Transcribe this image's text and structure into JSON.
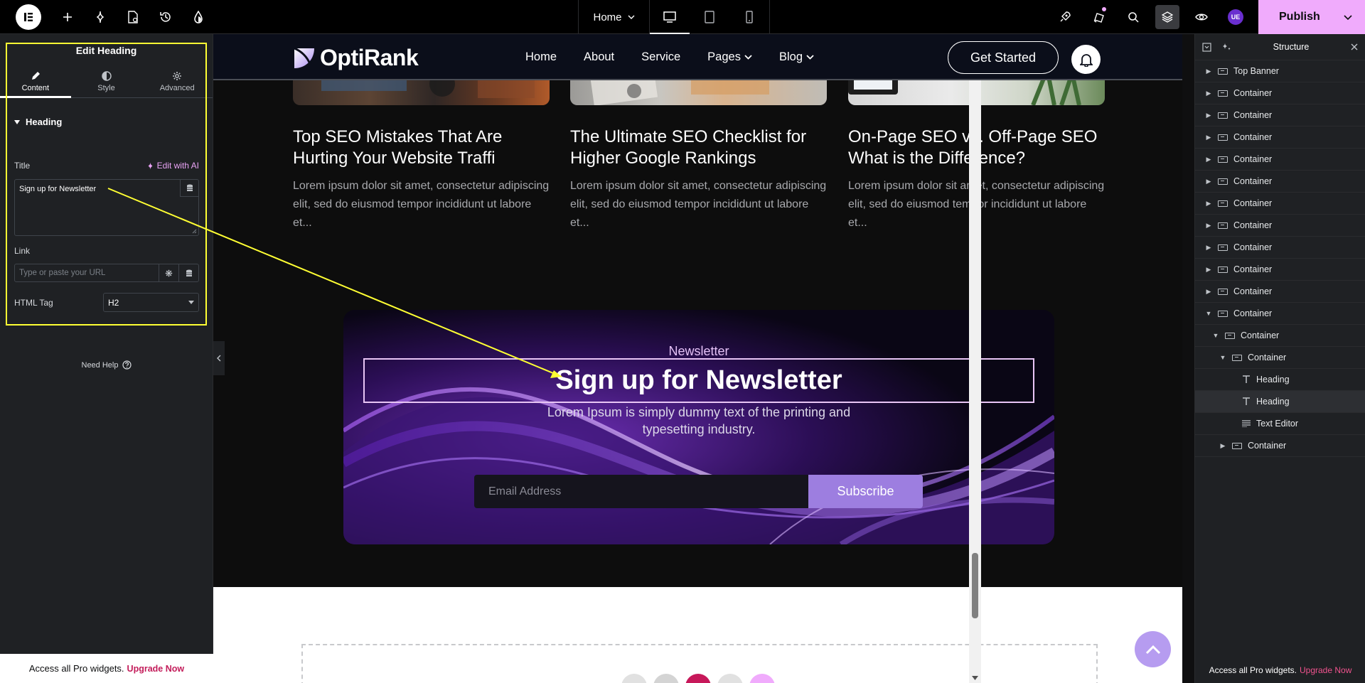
{
  "topbar": {
    "page_select": "Home",
    "publish_label": "Publish",
    "user_initials": "UE"
  },
  "left_panel": {
    "title": "Edit Heading",
    "tabs": [
      {
        "label": "Content",
        "icon": "pencil-icon",
        "active": true
      },
      {
        "label": "Style",
        "icon": "half-circle-icon",
        "active": false
      },
      {
        "label": "Advanced",
        "icon": "gear-icon",
        "active": false
      }
    ],
    "section_title": "Heading",
    "title_label": "Title",
    "edit_with_ai": "Edit with AI",
    "title_value": "Sign up for Newsletter",
    "link_label": "Link",
    "link_placeholder": "Type or paste your URL",
    "html_tag_label": "HTML Tag",
    "html_tag_value": "H2",
    "need_help": "Need Help",
    "pro_text": "Access all Pro widgets.",
    "upgrade": "Upgrade Now"
  },
  "site": {
    "brand": "OptiRank",
    "nav": [
      "Home",
      "About",
      "Service",
      "Pages",
      "Blog"
    ],
    "cta": "Get Started",
    "posts": [
      {
        "title": "Top SEO Mistakes That Are Hurting Your Website Traffi",
        "excerpt": "Lorem ipsum dolor sit amet, consectetur adipiscing elit, sed do eiusmod tempor incididunt ut labore et..."
      },
      {
        "title": "The Ultimate SEO Checklist for Higher Google Rankings",
        "excerpt": "Lorem ipsum dolor sit amet, consectetur adipiscing elit, sed do eiusmod tempor incididunt ut labore et..."
      },
      {
        "title": "On-Page SEO vs. Off-Page SEO What is the Difference?",
        "excerpt": "Lorem ipsum dolor sit amet, consectetur adipiscing elit, sed do eiusmod tempor incididunt ut labore et..."
      }
    ],
    "newsletter": {
      "eyebrow": "Newsletter",
      "heading": "Sign up for Newsletter",
      "text": "Lorem Ipsum is simply dummy text of the printing and typesetting industry.",
      "email_placeholder": "Email Address",
      "subscribe": "Subscribe"
    }
  },
  "structure": {
    "title": "Structure",
    "items": [
      {
        "label": "Top Banner",
        "depth": 0,
        "caret": "right",
        "icon": "container-icon"
      },
      {
        "label": "Container",
        "depth": 0,
        "caret": "right",
        "icon": "container-icon"
      },
      {
        "label": "Container",
        "depth": 0,
        "caret": "right",
        "icon": "container-icon"
      },
      {
        "label": "Container",
        "depth": 0,
        "caret": "right",
        "icon": "container-icon"
      },
      {
        "label": "Container",
        "depth": 0,
        "caret": "right",
        "icon": "container-icon"
      },
      {
        "label": "Container",
        "depth": 0,
        "caret": "right",
        "icon": "container-icon"
      },
      {
        "label": "Container",
        "depth": 0,
        "caret": "right",
        "icon": "container-icon"
      },
      {
        "label": "Container",
        "depth": 0,
        "caret": "right",
        "icon": "container-icon"
      },
      {
        "label": "Container",
        "depth": 0,
        "caret": "right",
        "icon": "container-icon"
      },
      {
        "label": "Container",
        "depth": 0,
        "caret": "right",
        "icon": "container-icon"
      },
      {
        "label": "Container",
        "depth": 0,
        "caret": "right",
        "icon": "container-icon"
      },
      {
        "label": "Container",
        "depth": 0,
        "caret": "down",
        "icon": "container-icon"
      },
      {
        "label": "Container",
        "depth": 1,
        "caret": "down",
        "icon": "container-icon"
      },
      {
        "label": "Container",
        "depth": 2,
        "caret": "down",
        "icon": "container-icon"
      },
      {
        "label": "Heading",
        "depth": 3,
        "caret": "none",
        "icon": "heading-icon"
      },
      {
        "label": "Heading",
        "depth": 3,
        "caret": "none",
        "icon": "heading-icon",
        "selected": true
      },
      {
        "label": "Text Editor",
        "depth": 3,
        "caret": "none",
        "icon": "text-editor-icon"
      },
      {
        "label": "Container",
        "depth": 2,
        "caret": "right",
        "icon": "container-icon"
      }
    ],
    "pro_text": "Access all Pro widgets.",
    "upgrade": "Upgrade Now"
  },
  "colors": {
    "accent": "#f0abfc",
    "highlight": "#ffff33",
    "upgrade": "#c31c5a"
  }
}
